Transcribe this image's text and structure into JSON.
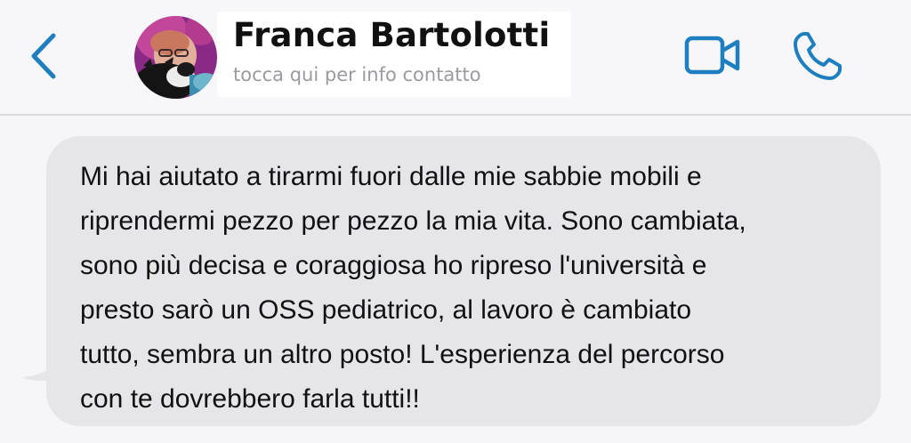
{
  "header": {
    "contact_name": "Franca Bartolotti",
    "contact_subtitle": "tocca qui per info contatto",
    "back_icon": "chevron-left-icon",
    "video_icon": "video-camera-icon",
    "call_icon": "phone-icon",
    "accent_color": "#1e7fc0"
  },
  "message": {
    "lines": [
      "Mi hai aiutato a tirarmi fuori dalle mie sabbie mobili e",
      "riprendermi pezzo per pezzo la mia vita. Sono cambiata,",
      "sono più decisa e coraggiosa ho ripreso l'università e",
      "presto sarò un OSS pediatrico, al lavoro è cambiato",
      "tutto, sembra un altro posto! L'esperienza del percorso",
      "con te dovrebbero farla tutti!!"
    ],
    "bubble_color": "#e5e5ea"
  }
}
